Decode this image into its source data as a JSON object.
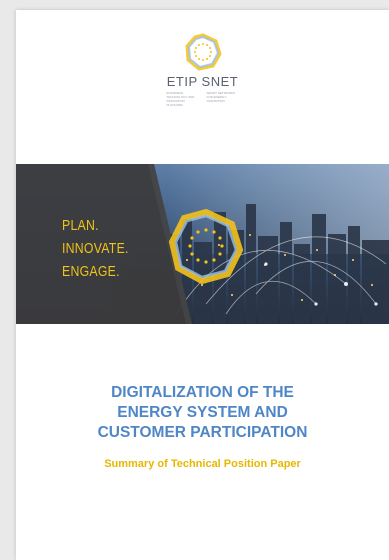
{
  "document": {
    "logo": {
      "name": "ETIP SNET",
      "subtitle_left": "EUROPEAN TECHNOLOGY AND INNOVATION PLATFORM",
      "subtitle_right": "SMART NETWORKS FOR ENERGY TRANSITION"
    },
    "banner": {
      "slogan_lines": [
        "PLAN.",
        "INNOVATE.",
        "ENGAGE."
      ]
    },
    "title_lines": [
      "DIGITALIZATION OF THE",
      "ENERGY SYSTEM AND",
      "CUSTOMER PARTICIPATION"
    ],
    "subtitle": "Summary of Technical Position Paper"
  },
  "colors": {
    "title": "#4f86c6",
    "subtitle": "#e6b800",
    "slogan": "#f0c419",
    "ring_yellow": "#f3c21b",
    "ring_blue": "#8ab4e0"
  }
}
